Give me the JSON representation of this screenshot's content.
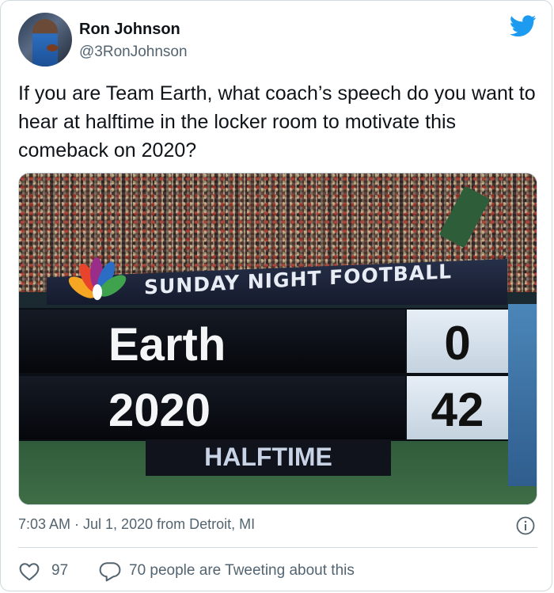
{
  "author": {
    "name": "Ron Johnson",
    "handle": "@3RonJohnson"
  },
  "tweet": {
    "text": "If you are Team Earth, what coach’s speech do you want to hear at halftime in the locker room to motivate this comeback on 2020?"
  },
  "media": {
    "broadcast_title": "SUNDAY NIGHT FOOTBALL",
    "teams": [
      {
        "name": "Earth",
        "score": "0"
      },
      {
        "name": "2020",
        "score": "42"
      }
    ],
    "period": "HALFTIME"
  },
  "meta": {
    "timestamp": "7:03 AM · Jul 1, 2020 from Detroit, MI"
  },
  "actions": {
    "like_count": "97",
    "reply_text": "70 people are Tweeting about this"
  },
  "colors": {
    "twitter_blue": "#1d9bf0",
    "muted_text": "#536471",
    "primary_text": "#0f1419"
  },
  "icons": [
    "twitter-bird-icon",
    "info-icon",
    "heart-icon",
    "reply-icon",
    "nbc-peacock-icon"
  ]
}
